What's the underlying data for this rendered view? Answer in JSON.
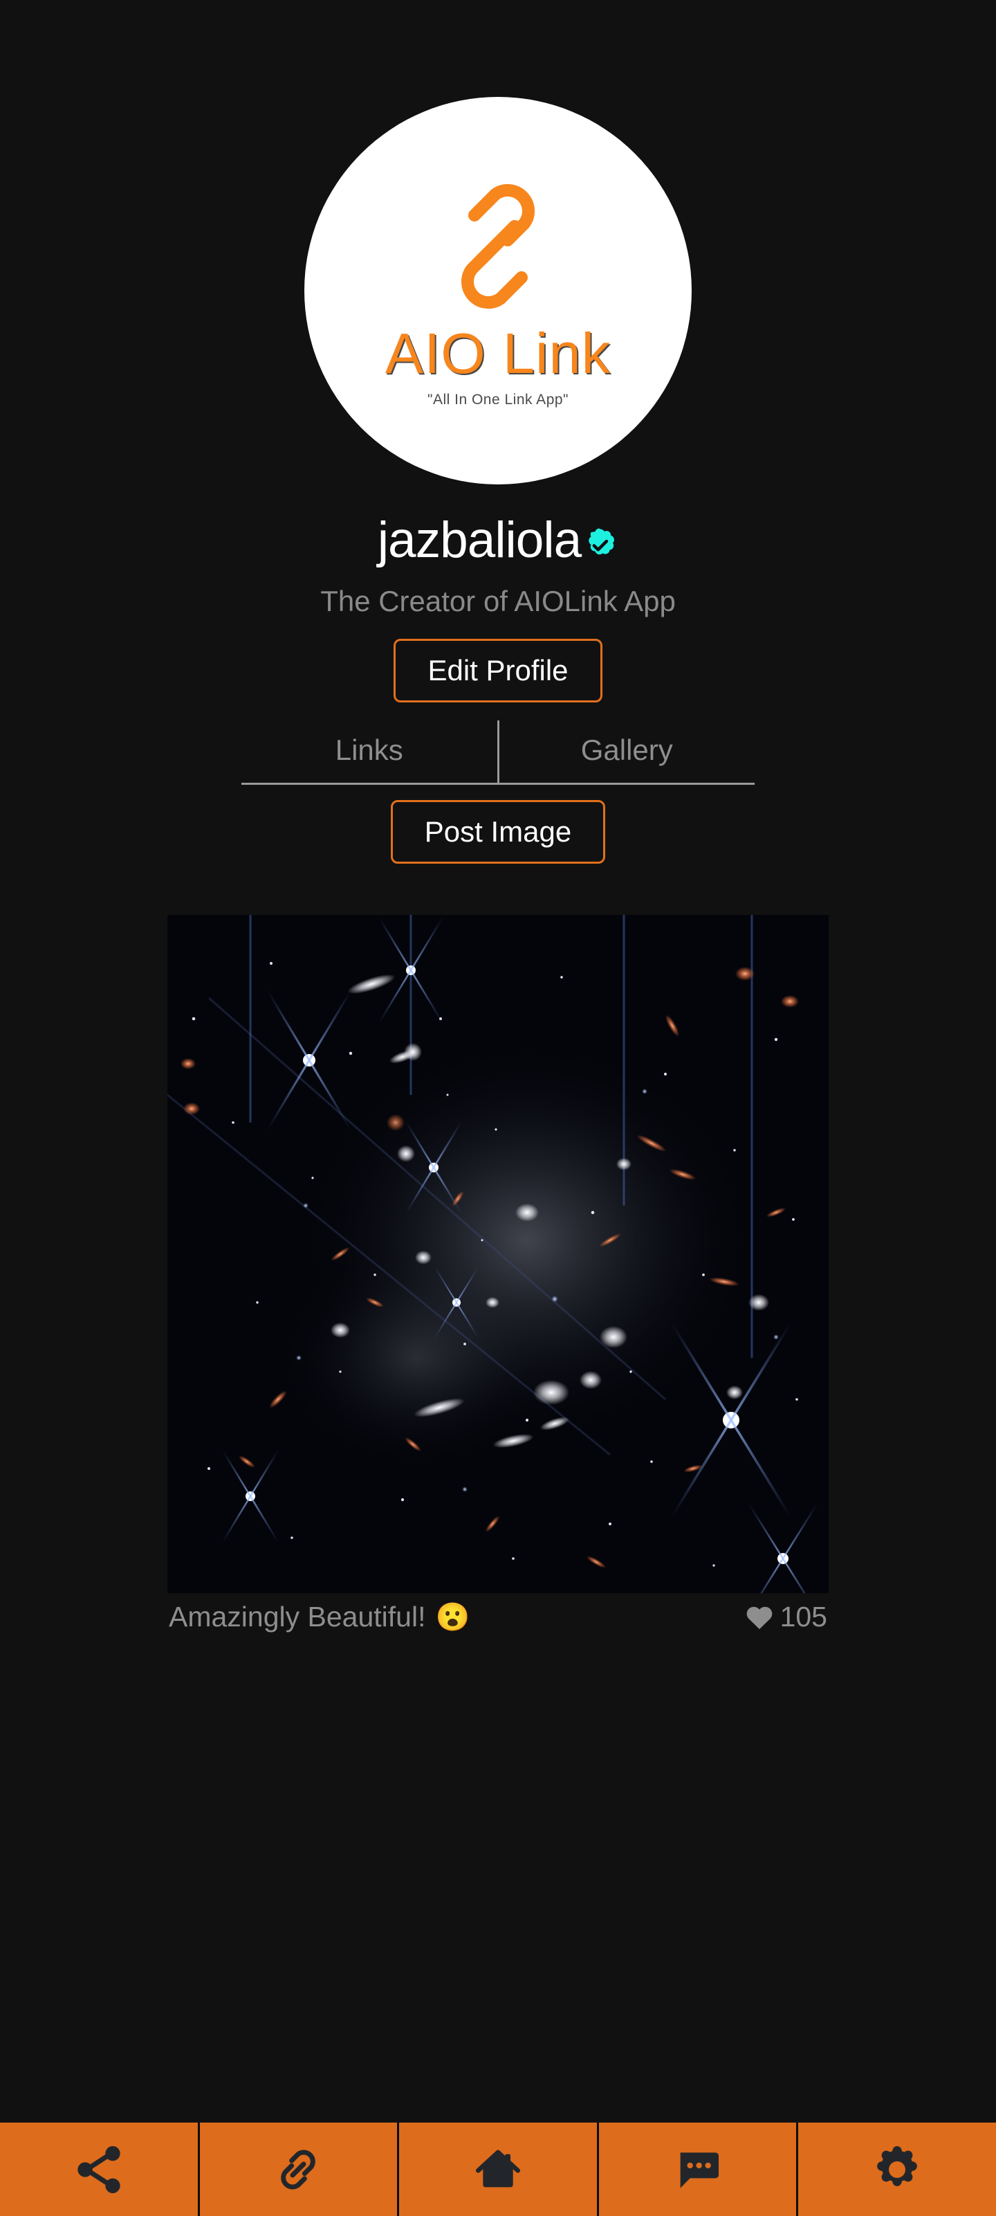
{
  "theme": {
    "background": "#111111",
    "accent_orange": "#DD6C1C",
    "button_border": "#E2701D",
    "verified_cyan": "#1EF0E0",
    "muted_text": "#8e8e8e",
    "nav_icon_color": "#22262B"
  },
  "avatar": {
    "logo_title": "AIO Link",
    "logo_tagline": "\"All In One Link App\"",
    "icon_name": "chain-link-icon"
  },
  "profile": {
    "username": "jazbaliola",
    "verified": true,
    "verified_icon": "verified-badge-icon",
    "bio": "The Creator of AIOLink App",
    "edit_profile_label": "Edit Profile"
  },
  "tabs": [
    {
      "label": "Links",
      "active": false
    },
    {
      "label": "Gallery",
      "active": true
    }
  ],
  "gallery": {
    "post_image_label": "Post Image",
    "posts": [
      {
        "image_alt": "deep-field-galaxy-photo",
        "caption": "Amazingly Beautiful!",
        "caption_emoji": "😮",
        "like_icon": "heart-icon",
        "likes": "105"
      }
    ]
  },
  "bottom_nav": [
    {
      "icon": "share-icon",
      "label": "Share"
    },
    {
      "icon": "link-icon",
      "label": "Links"
    },
    {
      "icon": "home-icon",
      "label": "Home"
    },
    {
      "icon": "chat-icon",
      "label": "Messages"
    },
    {
      "icon": "gear-icon",
      "label": "Settings"
    }
  ]
}
